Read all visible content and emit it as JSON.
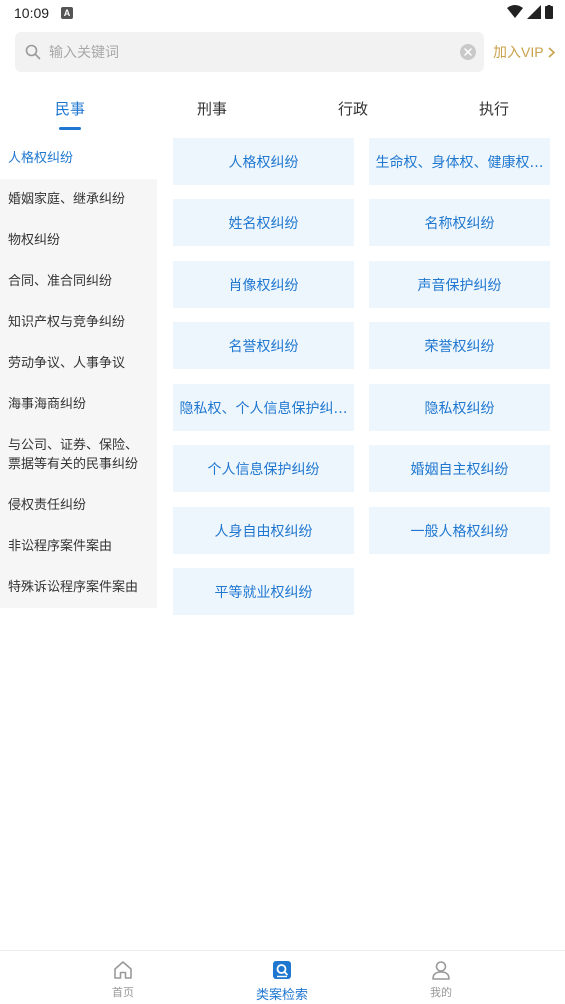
{
  "status_bar": {
    "time": "10:09",
    "app_icon_letter": "A"
  },
  "search": {
    "placeholder": "输入关键词",
    "vip_label": "加入VIP"
  },
  "tabs": [
    {
      "label": "民事",
      "active": true
    },
    {
      "label": "刑事",
      "active": false
    },
    {
      "label": "行政",
      "active": false
    },
    {
      "label": "执行",
      "active": false
    }
  ],
  "sidebar": {
    "items": [
      {
        "label": "人格权纠纷",
        "active": true
      },
      {
        "label": "婚姻家庭、继承纠纷"
      },
      {
        "label": "物权纠纷"
      },
      {
        "label": "合同、准合同纠纷"
      },
      {
        "label": "知识产权与竞争纠纷"
      },
      {
        "label": "劳动争议、人事争议"
      },
      {
        "label": "海事海商纠纷"
      },
      {
        "label": "与公司、证券、保险、票据等有关的民事纠纷"
      },
      {
        "label": "侵权责任纠纷"
      },
      {
        "label": "非讼程序案件案由"
      },
      {
        "label": "特殊诉讼程序案件案由"
      }
    ]
  },
  "grid": {
    "items": [
      "人格权纠纷",
      "生命权、身体权、健康权…",
      "姓名权纠纷",
      "名称权纠纷",
      "肖像权纠纷",
      "声音保护纠纷",
      "名誉权纠纷",
      "荣誉权纠纷",
      "隐私权、个人信息保护纠…",
      "隐私权纠纷",
      "个人信息保护纠纷",
      "婚姻自主权纠纷",
      "人身自由权纠纷",
      "一般人格权纠纷",
      "平等就业权纠纷"
    ]
  },
  "bottom_nav": [
    {
      "label": "首页",
      "icon": "home-icon"
    },
    {
      "label": "类案检索",
      "icon": "search-doc-icon",
      "active": true
    },
    {
      "label": "我的",
      "icon": "user-icon"
    }
  ],
  "colors": {
    "accent": "#1f77d0",
    "cell_bg": "#eef6fd",
    "vip": "#c9a14a",
    "sidebar_bg": "#f6f6f6"
  }
}
